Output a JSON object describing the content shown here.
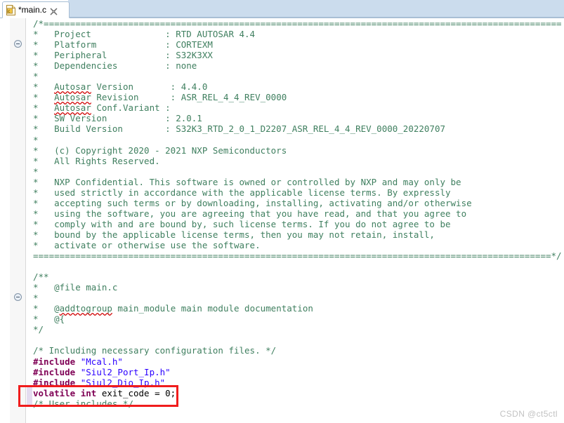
{
  "window": {
    "title": "main.c"
  },
  "tab": {
    "label": "*main.c",
    "icon": "c-file-icon",
    "close_icon": "close-icon",
    "dirty": true
  },
  "editor": {
    "language": "c",
    "fold_markers": [
      "collapse-icon",
      "collapse-icon"
    ],
    "change_bar_color": "#e4dcf0",
    "highlight_box_color": "#f01c1c",
    "highlighted_lines": [
      34,
      35
    ],
    "colors": {
      "comment": "#3f7f5f",
      "keyword": "#7f0055",
      "string": "#2a00ff",
      "plain": "#000000",
      "spellcheck_underline": "#d00000"
    },
    "lines": [
      {
        "n": 1,
        "fold": true,
        "segs": [
          {
            "t": "/*==================================================================================================",
            "c": "cmt"
          }
        ]
      },
      {
        "n": 2,
        "segs": [
          {
            "t": "*   Project              : RTD AUTOSAR 4.4",
            "c": "cmt"
          }
        ]
      },
      {
        "n": 3,
        "segs": [
          {
            "t": "*   Platform             : CORTEXM",
            "c": "cmt"
          }
        ]
      },
      {
        "n": 4,
        "segs": [
          {
            "t": "*   Peripheral           : S32K3XX",
            "c": "cmt"
          }
        ]
      },
      {
        "n": 5,
        "segs": [
          {
            "t": "*   Dependencies         : none",
            "c": "cmt"
          }
        ]
      },
      {
        "n": 6,
        "segs": [
          {
            "t": "*",
            "c": "cmt"
          }
        ]
      },
      {
        "n": 7,
        "segs": [
          {
            "t": "*   ",
            "c": "cmt"
          },
          {
            "t": "Autosar",
            "c": "cmt",
            "sp": true
          },
          {
            "t": " Version       : 4.4.0",
            "c": "cmt"
          }
        ]
      },
      {
        "n": 8,
        "segs": [
          {
            "t": "*   ",
            "c": "cmt"
          },
          {
            "t": "Autosar",
            "c": "cmt",
            "sp": true
          },
          {
            "t": " Revision      : ASR_REL_4_4_REV_0000",
            "c": "cmt"
          }
        ]
      },
      {
        "n": 9,
        "segs": [
          {
            "t": "*   ",
            "c": "cmt"
          },
          {
            "t": "Autosar",
            "c": "cmt",
            "sp": true
          },
          {
            "t": " Conf.Variant :",
            "c": "cmt"
          }
        ]
      },
      {
        "n": 10,
        "segs": [
          {
            "t": "*   SW Version           : 2.0.1",
            "c": "cmt"
          }
        ]
      },
      {
        "n": 11,
        "segs": [
          {
            "t": "*   Build Version        : S32K3_RTD_2_0_1_D2207_ASR_REL_4_4_REV_0000_20220707",
            "c": "cmt"
          }
        ]
      },
      {
        "n": 12,
        "segs": [
          {
            "t": "*",
            "c": "cmt"
          }
        ]
      },
      {
        "n": 13,
        "segs": [
          {
            "t": "*   (c) Copyright 2020 - 2021 NXP Semiconductors",
            "c": "cmt"
          }
        ]
      },
      {
        "n": 14,
        "segs": [
          {
            "t": "*   All Rights Reserved.",
            "c": "cmt"
          }
        ]
      },
      {
        "n": 15,
        "segs": [
          {
            "t": "*",
            "c": "cmt"
          }
        ]
      },
      {
        "n": 16,
        "segs": [
          {
            "t": "*   NXP Confidential. This software is owned or controlled by NXP and may only be",
            "c": "cmt"
          }
        ]
      },
      {
        "n": 17,
        "segs": [
          {
            "t": "*   used strictly in accordance with the applicable license terms. By expressly",
            "c": "cmt"
          }
        ]
      },
      {
        "n": 18,
        "segs": [
          {
            "t": "*   accepting such terms or by downloading, installing, activating and/or otherwise",
            "c": "cmt"
          }
        ]
      },
      {
        "n": 19,
        "segs": [
          {
            "t": "*   using the software, you are agreeing that you have read, and that you agree to",
            "c": "cmt"
          }
        ]
      },
      {
        "n": 20,
        "segs": [
          {
            "t": "*   comply with and are bound by, such license terms. If you do not agree to be",
            "c": "cmt"
          }
        ]
      },
      {
        "n": 21,
        "segs": [
          {
            "t": "*   bound by the applicable license terms, then you may not retain, install,",
            "c": "cmt"
          }
        ]
      },
      {
        "n": 22,
        "segs": [
          {
            "t": "*   activate or otherwise use the software.",
            "c": "cmt"
          }
        ]
      },
      {
        "n": 23,
        "segs": [
          {
            "t": "==================================================================================================*/",
            "c": "cmt"
          }
        ]
      },
      {
        "n": 24,
        "segs": []
      },
      {
        "n": 25,
        "fold": true,
        "segs": [
          {
            "t": "/**",
            "c": "cmt"
          }
        ]
      },
      {
        "n": 26,
        "segs": [
          {
            "t": "*   @file main.c",
            "c": "cmt"
          }
        ]
      },
      {
        "n": 27,
        "segs": [
          {
            "t": "*",
            "c": "cmt"
          }
        ]
      },
      {
        "n": 28,
        "segs": [
          {
            "t": "*   @",
            "c": "cmt"
          },
          {
            "t": "addtogroup",
            "c": "cmt",
            "sp": true
          },
          {
            "t": " main_module main module documentation",
            "c": "cmt"
          }
        ]
      },
      {
        "n": 29,
        "segs": [
          {
            "t": "*   @{",
            "c": "cmt"
          }
        ]
      },
      {
        "n": 30,
        "segs": [
          {
            "t": "*/",
            "c": "cmt"
          }
        ]
      },
      {
        "n": 31,
        "segs": []
      },
      {
        "n": 32,
        "segs": [
          {
            "t": "/* Including necessary configuration files. */",
            "c": "cmt"
          }
        ]
      },
      {
        "n": 33,
        "segs": [
          {
            "t": "#include",
            "c": "kw"
          },
          {
            "t": " ",
            "c": "plain"
          },
          {
            "t": "\"Mcal.h\"",
            "c": "str"
          }
        ]
      },
      {
        "n": 34,
        "segs": [
          {
            "t": "#include",
            "c": "kw"
          },
          {
            "t": " ",
            "c": "plain"
          },
          {
            "t": "\"Siul2_Port_Ip.h\"",
            "c": "str"
          }
        ]
      },
      {
        "n": 35,
        "segs": [
          {
            "t": "#include",
            "c": "kw"
          },
          {
            "t": " ",
            "c": "plain"
          },
          {
            "t": "\"Siul2_Dio_Ip.h\"",
            "c": "str"
          }
        ]
      },
      {
        "n": 36,
        "segs": [
          {
            "t": "volatile",
            "c": "kw"
          },
          {
            "t": " ",
            "c": "plain"
          },
          {
            "t": "int",
            "c": "kw"
          },
          {
            "t": " exit_code = 0;",
            "c": "plain"
          }
        ]
      },
      {
        "n": 37,
        "segs": [
          {
            "t": "/* User includes */",
            "c": "cmt"
          }
        ]
      }
    ]
  },
  "watermark": {
    "text": "CSDN @ct5ctl"
  }
}
